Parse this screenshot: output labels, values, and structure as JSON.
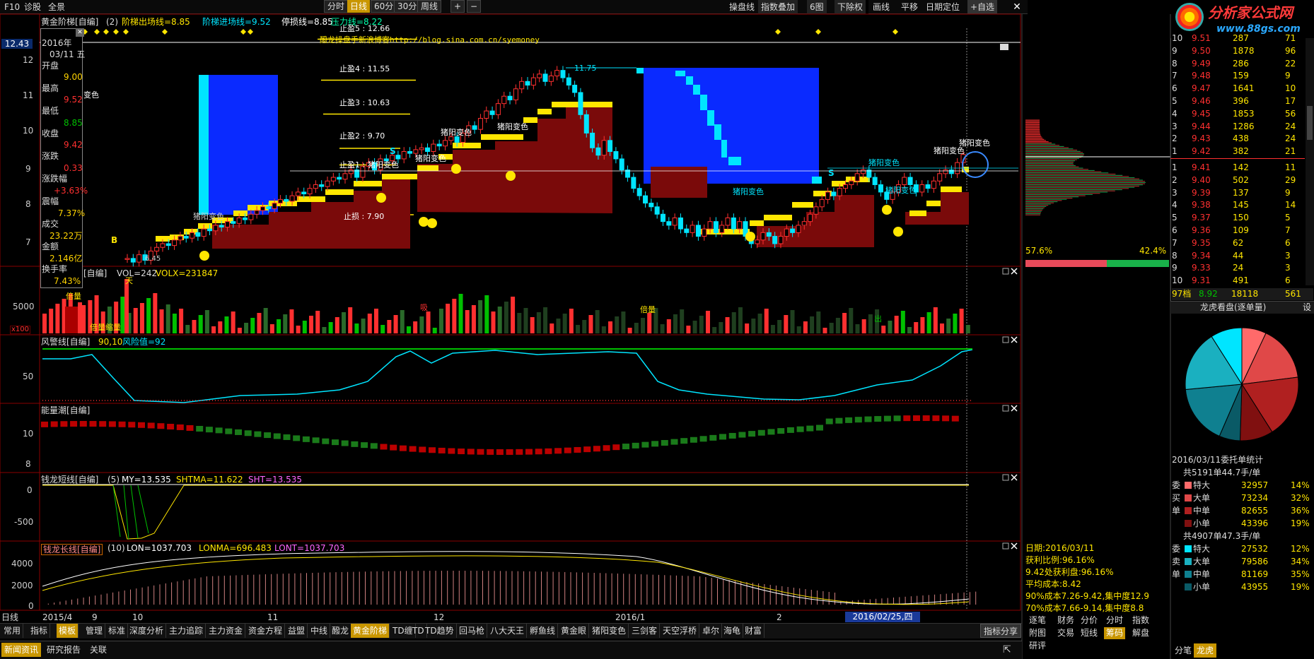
{
  "toolbar": {
    "f10": "F10",
    "diagnose": "诊股",
    "fullview": "全景",
    "periods": [
      "分时",
      "日线",
      "60分",
      "30分",
      "周线"
    ],
    "right_items": [
      "操盘线",
      "指数叠加",
      "6图",
      "下除权",
      "画线",
      "平移",
      "日期定位",
      "+自选"
    ],
    "plus": "+",
    "minus": "−"
  },
  "logo": {
    "text": "分析家公式网",
    "url": "www.88gs.com"
  },
  "main_chart": {
    "title": "黄金阶梯[自编]",
    "params": "(2)",
    "line1": "阶梯出场线=8.85",
    "line2": "阶梯进场线=9.52",
    "line3": "停损线=8.85",
    "line4": "压力线=8.22",
    "blog": "醱龙操盘手新浪博客http://blog.sina.com.cn/syemoney",
    "price_ticks": [
      "12",
      "11",
      "10",
      "9",
      "8",
      "7"
    ],
    "price_now": "12.43",
    "tp5": "止盈5  : 12.66",
    "tp4": "止盈4  : 11.55",
    "tp3": "止盈3  : 10.63",
    "tp2": "止盈2  : 9.70",
    "tp1": "止盈1  :",
    "sl": "止损  : 7.90",
    "peak": "11.75",
    "low": "6.45",
    "labels": [
      "猪阳变色",
      "猪阳变色",
      "猪阳变色",
      "猪阳变色",
      "猪阳变色",
      "猪阳变色",
      "猪阳变色",
      "猪阳变色",
      "猪阳变色",
      "猪阳变色",
      "变色"
    ],
    "s_mark": "S",
    "b_mark": "B"
  },
  "info_panel": {
    "year": "2016年",
    "date": "03/11 五",
    "open_label": "开盘",
    "open": "9.00",
    "high_label": "最高",
    "high": "9.52",
    "low_label": "最低",
    "low": "8.85",
    "close_label": "收盘",
    "close": "9.42",
    "chg_label": "涨跌",
    "chg": "0.33",
    "pct_label": "涨跌幅",
    "pct": "+3.63%",
    "amp_label": "震幅",
    "amp": "7.37%",
    "vol_label": "成交",
    "vol": "23.22万",
    "amt_label": "金额",
    "amt": "2.146亿",
    "turn_label": "换手率",
    "turn": "7.43%"
  },
  "vol_panel": {
    "title": "[自编]",
    "p1": "VOL=242",
    "p2": "VOLX=231847",
    "tick": "5000",
    "unit": "x100",
    "labels": [
      "倍量",
      "倍量缩量",
      "吸",
      "倍量",
      "出",
      "天"
    ]
  },
  "risk_panel": {
    "title": "风警线[自编]",
    "p1": "90,10",
    "p2": "风险值=92",
    "tick": "50"
  },
  "energy_panel": {
    "title": "能量潮[自编]",
    "ticks": [
      "10",
      "8"
    ]
  },
  "short_panel": {
    "title": "钱龙短线[自编]",
    "params": "(5)",
    "p1": "MY=13.535",
    "p2": "SHTMA=11.622",
    "p3": "SHT=13.535",
    "ticks": [
      "0",
      "-500"
    ]
  },
  "long_panel": {
    "title": "钱龙长线[自编]",
    "params": "(10)",
    "p1": "LON=1037.703",
    "p2": "LONMA=696.483",
    "p3": "LONT=1037.703",
    "ticks": [
      "4000",
      "2000",
      "0"
    ]
  },
  "xaxis": {
    "label": "日线",
    "dates": [
      "2015/4",
      "9",
      "10",
      "11",
      "12",
      "2016/1",
      "2",
      "2016/02/25,四"
    ]
  },
  "bottom_tabs": [
    "常用",
    "指标",
    "模板",
    "管理",
    "标准",
    "深度分析",
    "主力追踪",
    "主力资金",
    "资金方程",
    "益盟",
    "中线",
    "醱龙",
    "黄金阶梯",
    "TD缠",
    "TD",
    "TD趋势",
    "回马枪",
    "八大天王",
    "孵鱼线",
    "黄金眼",
    "猪阳变色",
    "三剑客",
    "天空浮桥",
    "卓尔",
    "海龟",
    "财富"
  ],
  "share_btn": "指标分享",
  "news_bar": [
    "新闻资讯",
    "研究报告",
    "关联"
  ],
  "chips": {
    "pct_left": "57.6%",
    "pct_right": "42.4%",
    "date": "日期:2016/03/11",
    "profit": "获利比例:96.16%",
    "profit2": "9.42处获利盘:96.16%",
    "avg": "平均成本:8.42",
    "c90": "90%成本7.26-9.42,集中度12.9",
    "c70": "70%成本7.66-9.14,集中度8.8"
  },
  "chip_tabs": [
    "逐笔",
    "财务",
    "分价",
    "分时",
    "指数",
    "附图",
    "交易",
    "短线",
    "筹码",
    "解盘",
    "研评"
  ],
  "orderbook": {
    "sell": [
      [
        "10",
        "9.51",
        "287",
        "71"
      ],
      [
        "9",
        "9.50",
        "1878",
        "96"
      ],
      [
        "8",
        "9.49",
        "286",
        "22"
      ],
      [
        "7",
        "9.48",
        "159",
        "9"
      ],
      [
        "6",
        "9.47",
        "1641",
        "10"
      ],
      [
        "5",
        "9.46",
        "396",
        "17"
      ],
      [
        "4",
        "9.45",
        "1853",
        "56"
      ],
      [
        "3",
        "9.44",
        "1286",
        "24"
      ],
      [
        "2",
        "9.43",
        "438",
        "24"
      ],
      [
        "1",
        "9.42",
        "382",
        "21"
      ]
    ],
    "buy": [
      [
        "1",
        "9.41",
        "142",
        "11"
      ],
      [
        "2",
        "9.40",
        "502",
        "29"
      ],
      [
        "3",
        "9.39",
        "137",
        "9"
      ],
      [
        "4",
        "9.38",
        "145",
        "14"
      ],
      [
        "5",
        "9.37",
        "150",
        "5"
      ],
      [
        "6",
        "9.36",
        "109",
        "7"
      ],
      [
        "7",
        "9.35",
        "62",
        "6"
      ],
      [
        "8",
        "9.34",
        "44",
        "3"
      ],
      [
        "9",
        "9.33",
        "24",
        "3"
      ],
      [
        "10",
        "9.31",
        "491",
        "6"
      ]
    ],
    "total": [
      "97档",
      "8.92",
      "18118",
      "561"
    ]
  },
  "dragon": {
    "title": "龙虎看盘(逐单量)",
    "set": "设",
    "stat_title": "2016/03/11委托单统计",
    "buy_total": "共5191单44.7手/单",
    "sell_total": "共4907单47.3手/单",
    "buy_side": [
      "委",
      "买",
      "单"
    ],
    "sell_side": [
      "委",
      "卖",
      "单"
    ],
    "buy": [
      [
        "特大",
        "32957",
        "14%"
      ],
      [
        "大单",
        "73234",
        "32%"
      ],
      [
        "中单",
        "82655",
        "36%"
      ],
      [
        "小单",
        "43396",
        "19%"
      ]
    ],
    "sell": [
      [
        "特大",
        "27532",
        "12%"
      ],
      [
        "大单",
        "79586",
        "34%"
      ],
      [
        "中单",
        "81169",
        "35%"
      ],
      [
        "小单",
        "43955",
        "19%"
      ]
    ],
    "tabs": [
      "分笔",
      "龙虎"
    ]
  },
  "colors": {
    "up": "#ff3030",
    "down": "#00e5ff",
    "yellow": "#ffe600",
    "blue": "#0a2aff",
    "maroon": "#7a0a0a",
    "green": "#00c000"
  }
}
